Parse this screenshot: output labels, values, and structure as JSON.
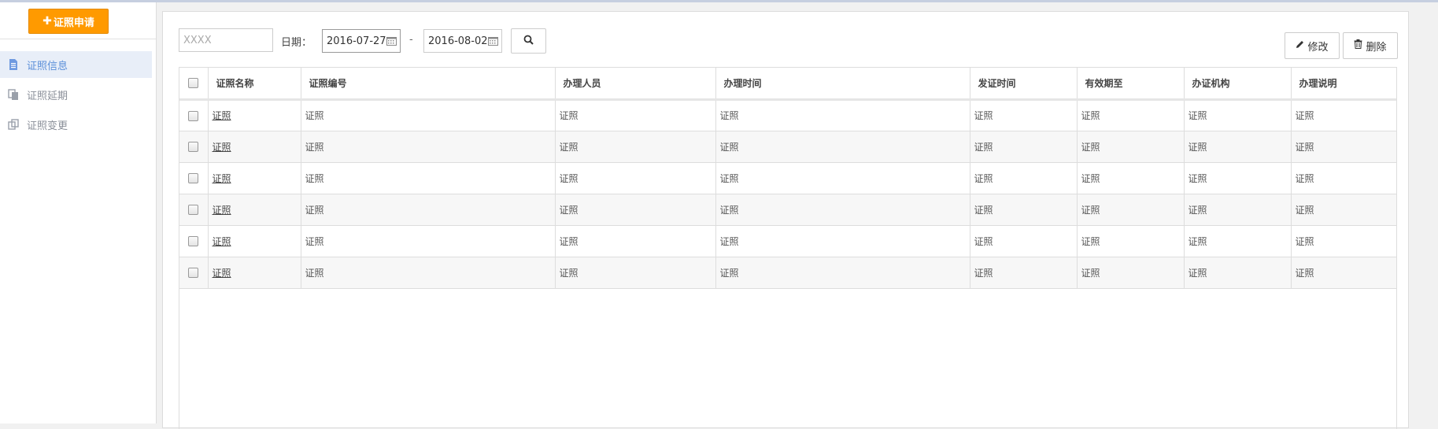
{
  "sidebar": {
    "apply_button": "证照申请",
    "items": [
      {
        "label": "证照信息",
        "icon": "document-icon",
        "active": true
      },
      {
        "label": "证照延期",
        "icon": "copy-icon",
        "active": false
      },
      {
        "label": "证照变更",
        "icon": "change-icon",
        "active": false
      }
    ]
  },
  "toolbar": {
    "search_placeholder": "XXXX",
    "date_label": "日期：",
    "date_from": "2016-07-27",
    "date_separator": "-",
    "date_to": "2016-08-02",
    "edit_label": "修改",
    "delete_label": "删除"
  },
  "table": {
    "columns": [
      "证照名称",
      "证照编号",
      "办理人员",
      "办理时间",
      "发证时间",
      "有效期至",
      "办证机构",
      "办理说明"
    ],
    "rows": [
      [
        "证照",
        "证照",
        "证照",
        "证照",
        "证照",
        "证照",
        "证照",
        "证照"
      ],
      [
        "证照",
        "证照",
        "证照",
        "证照",
        "证照",
        "证照",
        "证照",
        "证照"
      ],
      [
        "证照",
        "证照",
        "证照",
        "证照",
        "证照",
        "证照",
        "证照",
        "证照"
      ],
      [
        "证照",
        "证照",
        "证照",
        "证照",
        "证照",
        "证照",
        "证照",
        "证照"
      ],
      [
        "证照",
        "证照",
        "证照",
        "证照",
        "证照",
        "证照",
        "证照",
        "证照"
      ],
      [
        "证照",
        "证照",
        "证照",
        "证照",
        "证照",
        "证照",
        "证照",
        "证照"
      ]
    ]
  },
  "colors": {
    "accent_orange": "#ff9a00",
    "active_blue": "#5b8fd9",
    "active_bg": "#e8eef8"
  }
}
